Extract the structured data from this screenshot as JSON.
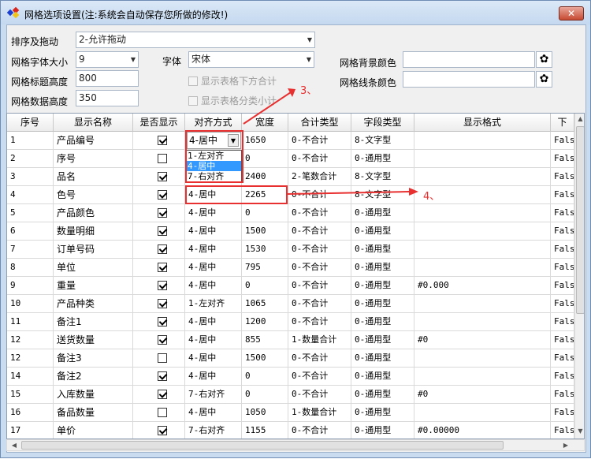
{
  "window": {
    "title": "网格选项设置(注:系统会自动保存您所做的修改!)",
    "close_label": "✕"
  },
  "form": {
    "sort_label": "排序及拖动",
    "sort_value": "2-允许拖动",
    "font_size_label": "网格字体大小",
    "font_size_value": "9",
    "font_label": "字体",
    "font_value": "宋体",
    "bg_color_label": "网格背景颜色",
    "line_color_label": "网格线条颜色",
    "header_height_label": "网格标题高度",
    "header_height_value": "800",
    "data_height_label": "网格数据高度",
    "data_height_value": "350",
    "show_sum_label": "显示表格下方合计",
    "show_group_label": "显示表格分类小计"
  },
  "grid": {
    "columns": [
      "序号",
      "显示名称",
      "是否显示",
      "对齐方式",
      "宽度",
      "合计类型",
      "字段类型",
      "显示格式",
      "下"
    ],
    "rows": [
      {
        "n": "1",
        "name": "产品编号",
        "show": true,
        "align": "4-居中",
        "width": "1650",
        "sum": "0-不合计",
        "type": "8-文字型",
        "fmt": "",
        "last": "Fals"
      },
      {
        "n": "2",
        "name": "序号",
        "show": false,
        "align": "1-左对齐",
        "width": "0",
        "sum": "0-不合计",
        "type": "0-通用型",
        "fmt": "",
        "last": "Fals"
      },
      {
        "n": "3",
        "name": "品名",
        "show": true,
        "align": "7-右对齐",
        "width": "2400",
        "sum": "2-笔数合计",
        "type": "8-文字型",
        "fmt": "",
        "last": "Fals"
      },
      {
        "n": "4",
        "name": "色号",
        "show": true,
        "align": "4-居中",
        "width": "2265",
        "sum": "0-不合计",
        "type": "8-文字型",
        "fmt": "",
        "last": "Fals"
      },
      {
        "n": "5",
        "name": "产品颜色",
        "show": true,
        "align": "4-居中",
        "width": "0",
        "sum": "0-不合计",
        "type": "0-通用型",
        "fmt": "",
        "last": "Fals"
      },
      {
        "n": "6",
        "name": "数量明细",
        "show": true,
        "align": "4-居中",
        "width": "1500",
        "sum": "0-不合计",
        "type": "0-通用型",
        "fmt": "",
        "last": "Fals"
      },
      {
        "n": "7",
        "name": "订单号码",
        "show": true,
        "align": "4-居中",
        "width": "1530",
        "sum": "0-不合计",
        "type": "0-通用型",
        "fmt": "",
        "last": "Fals"
      },
      {
        "n": "8",
        "name": "单位",
        "show": true,
        "align": "4-居中",
        "width": "795",
        "sum": "0-不合计",
        "type": "0-通用型",
        "fmt": "",
        "last": "Fals"
      },
      {
        "n": "9",
        "name": "重量",
        "show": true,
        "align": "4-居中",
        "width": "0",
        "sum": "0-不合计",
        "type": "0-通用型",
        "fmt": "#0.000",
        "last": "Fals"
      },
      {
        "n": "10",
        "name": "产品种类",
        "show": true,
        "align": "1-左对齐",
        "width": "1065",
        "sum": "0-不合计",
        "type": "0-通用型",
        "fmt": "",
        "last": "Fals"
      },
      {
        "n": "11",
        "name": "备注1",
        "show": true,
        "align": "4-居中",
        "width": "1200",
        "sum": "0-不合计",
        "type": "0-通用型",
        "fmt": "",
        "last": "Fals"
      },
      {
        "n": "12",
        "name": "送货数量",
        "show": true,
        "align": "4-居中",
        "width": "855",
        "sum": "1-数量合计",
        "type": "0-通用型",
        "fmt": "#0",
        "last": "Fals"
      },
      {
        "n": "12",
        "name": "备注3",
        "show": false,
        "align": "4-居中",
        "width": "1500",
        "sum": "0-不合计",
        "type": "0-通用型",
        "fmt": "",
        "last": "Fals"
      },
      {
        "n": "14",
        "name": "备注2",
        "show": true,
        "align": "4-居中",
        "width": "0",
        "sum": "0-不合计",
        "type": "0-通用型",
        "fmt": "",
        "last": "Fals"
      },
      {
        "n": "15",
        "name": "入库数量",
        "show": true,
        "align": "7-右对齐",
        "width": "0",
        "sum": "0-不合计",
        "type": "0-通用型",
        "fmt": "#0",
        "last": "Fals"
      },
      {
        "n": "16",
        "name": "备品数量",
        "show": false,
        "align": "4-居中",
        "width": "1050",
        "sum": "1-数量合计",
        "type": "0-通用型",
        "fmt": "",
        "last": "Fals"
      },
      {
        "n": "17",
        "name": "单价",
        "show": true,
        "align": "7-右对齐",
        "width": "1155",
        "sum": "0-不合计",
        "type": "0-通用型",
        "fmt": "#0.00000",
        "last": "Fals"
      }
    ]
  },
  "dropdown": {
    "current": "4-居中",
    "options": [
      "1-左对齐",
      "4-居中",
      "7-右对齐"
    ],
    "selected_index": 1
  },
  "annotations": {
    "a3": "3、",
    "a4": "4、"
  }
}
